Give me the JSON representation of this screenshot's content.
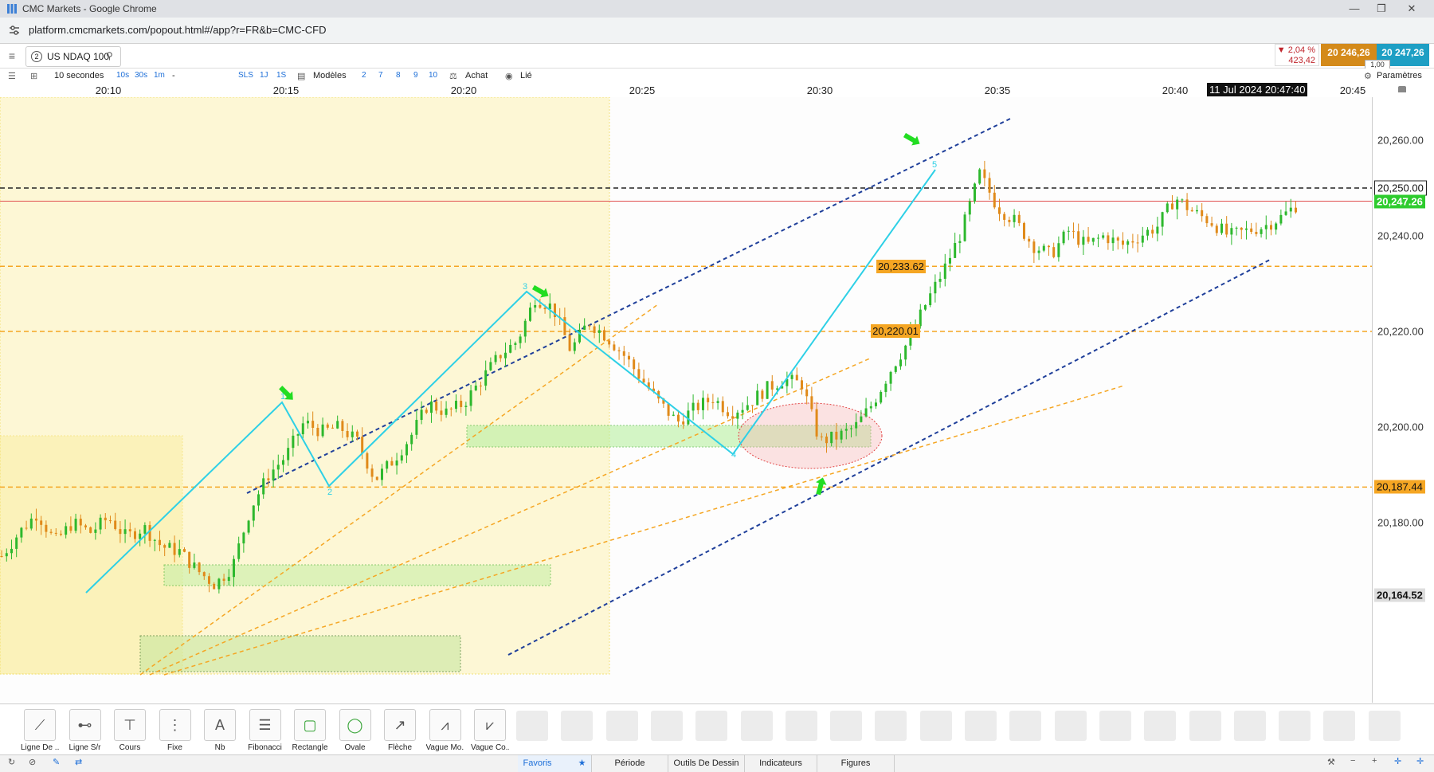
{
  "window": {
    "title": "CMC Markets - Google Chrome",
    "minimize": "—",
    "restore": "❐",
    "close": "✕"
  },
  "browser": {
    "url": "platform.cmcmarkets.com/popout.html#/app?r=FR&b=CMC-CFD"
  },
  "instrument": {
    "tab_number": "2",
    "name": "US NDAQ 100"
  },
  "quote": {
    "change_pct": "▼ 2,04 %",
    "change_points": "423,42",
    "sell": "20 246,26",
    "buy": "20 247,26",
    "spread": "1,00"
  },
  "toolbar": {
    "interval": "10 secondes",
    "interval_buttons": [
      "10s",
      "30s",
      "1m",
      "-"
    ],
    "order_buttons": [
      "SLS",
      "1J",
      "1S"
    ],
    "templates_label": "Modèles",
    "template_numbers": [
      "2",
      "7",
      "8",
      "9",
      "10"
    ],
    "buy_label": "Achat",
    "linked_label": "Lié",
    "settings_label": "Paramètres"
  },
  "time_axis": {
    "ticks": [
      "20:10",
      "20:15",
      "20:20",
      "20:25",
      "20:30",
      "20:35",
      "20:40",
      "20:45"
    ],
    "cursor_label": "11 Jul 2024 20:47:40"
  },
  "price_axis": {
    "ticks": [
      "20,260.00",
      "20,240.00",
      "20,220.00",
      "20,200.00",
      "20,180.00"
    ]
  },
  "price_levels": {
    "black_dashed": "20,250.00",
    "current": "20,247.26",
    "orange_1": "20,233.62",
    "orange_2": "20,220.01",
    "orange_3": "20,187.44",
    "axis_bottom": "20,164.52"
  },
  "wave_labels": [
    "1",
    "2",
    "3",
    "4",
    "5"
  ],
  "drawing_tools": [
    {
      "label": "Ligne De ...",
      "icon": "trend-line-icon"
    },
    {
      "label": "Ligne S/r",
      "icon": "sr-line-icon"
    },
    {
      "label": "Cours",
      "icon": "price-line-icon"
    },
    {
      "label": "Fixe",
      "icon": "fixed-line-icon"
    },
    {
      "label": "Nb",
      "icon": "text-note-icon"
    },
    {
      "label": "Fibonacci",
      "icon": "fibonacci-icon"
    },
    {
      "label": "Rectangle",
      "icon": "rectangle-icon"
    },
    {
      "label": "Ovale",
      "icon": "oval-icon"
    },
    {
      "label": "Flèche",
      "icon": "arrow-icon"
    },
    {
      "label": "Vague Mo...",
      "icon": "wave-motive-icon"
    },
    {
      "label": "Vague Co...",
      "icon": "wave-corrective-icon"
    }
  ],
  "bottom_tabs": [
    "Favoris",
    "Période",
    "Outils De Dessin",
    "Indicateurs",
    "Figures"
  ],
  "chart_data": {
    "type": "candlestick",
    "instrument": "US NDAQ 100",
    "interval": "10 secondes",
    "x_ticks": [
      "20:10",
      "20:15",
      "20:20",
      "20:25",
      "20:30",
      "20:35",
      "20:40",
      "20:45"
    ],
    "y_ticks": [
      20260,
      20240,
      20220,
      20200,
      20180
    ],
    "ylim": [
      20163,
      20272
    ],
    "close_path": [
      [
        "20:07:00",
        20173
      ],
      [
        "20:07:30",
        20178
      ],
      [
        "20:08:00",
        20182
      ],
      [
        "20:08:30",
        20176
      ],
      [
        "20:09:00",
        20180
      ],
      [
        "20:09:30",
        20178
      ],
      [
        "20:10:00",
        20181
      ],
      [
        "20:10:30",
        20177
      ],
      [
        "20:11:00",
        20179
      ],
      [
        "20:11:30",
        20175
      ],
      [
        "20:12:00",
        20174
      ],
      [
        "20:12:30",
        20170
      ],
      [
        "20:13:00",
        20167
      ],
      [
        "20:13:30",
        20171
      ],
      [
        "20:14:00",
        20183
      ],
      [
        "20:14:30",
        20190
      ],
      [
        "20:15:00",
        20194
      ],
      [
        "20:15:30",
        20201
      ],
      [
        "20:16:00",
        20199
      ],
      [
        "20:16:30",
        20200
      ],
      [
        "20:17:00",
        20197
      ],
      [
        "20:17:30",
        20189
      ],
      [
        "20:18:00",
        20193
      ],
      [
        "20:18:30",
        20198
      ],
      [
        "20:19:00",
        20205
      ],
      [
        "20:19:30",
        20203
      ],
      [
        "20:20:00",
        20205
      ],
      [
        "20:20:30",
        20210
      ],
      [
        "20:21:00",
        20215
      ],
      [
        "20:21:30",
        20218
      ],
      [
        "20:22:00",
        20227
      ],
      [
        "20:22:30",
        20225
      ],
      [
        "20:23:00",
        20216
      ],
      [
        "20:23:30",
        20222
      ],
      [
        "20:24:00",
        20219
      ],
      [
        "20:24:30",
        20215
      ],
      [
        "20:25:00",
        20210
      ],
      [
        "20:25:30",
        20205
      ],
      [
        "20:26:00",
        20201
      ],
      [
        "20:26:30",
        20204
      ],
      [
        "20:27:00",
        20206
      ],
      [
        "20:27:30",
        20203
      ],
      [
        "20:28:00",
        20205
      ],
      [
        "20:28:30",
        20208
      ],
      [
        "20:29:00",
        20210
      ],
      [
        "20:29:30",
        20209
      ],
      [
        "20:30:00",
        20197
      ],
      [
        "20:30:30",
        20198
      ],
      [
        "20:31:00",
        20200
      ],
      [
        "20:31:30",
        20205
      ],
      [
        "20:32:00",
        20212
      ],
      [
        "20:32:30",
        20218
      ],
      [
        "20:33:00",
        20226
      ],
      [
        "20:33:30",
        20233
      ],
      [
        "20:34:00",
        20241
      ],
      [
        "20:34:30",
        20253
      ],
      [
        "20:35:00",
        20246
      ],
      [
        "20:35:30",
        20243
      ],
      [
        "20:36:00",
        20238
      ],
      [
        "20:36:30",
        20236
      ],
      [
        "20:37:00",
        20241
      ],
      [
        "20:37:30",
        20238
      ],
      [
        "20:38:00",
        20240
      ],
      [
        "20:38:30",
        20238
      ],
      [
        "20:39:00",
        20240
      ],
      [
        "20:39:30",
        20242
      ],
      [
        "20:40:00",
        20248
      ],
      [
        "20:40:30",
        20245
      ],
      [
        "20:41:00",
        20243
      ],
      [
        "20:41:30",
        20240
      ],
      [
        "20:42:00",
        20241
      ],
      [
        "20:42:30",
        20242
      ],
      [
        "20:43:00",
        20244
      ],
      [
        "20:43:30",
        20247
      ]
    ]
  }
}
